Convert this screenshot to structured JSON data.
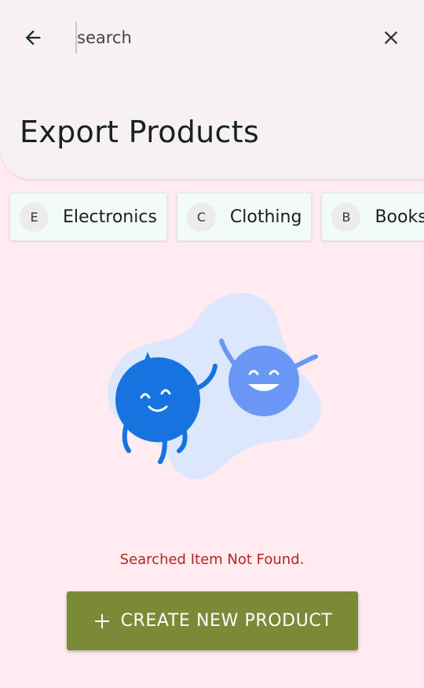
{
  "search": {
    "placeholder": "search",
    "value": ""
  },
  "header": {
    "title": "Export Products"
  },
  "categories": [
    {
      "initial": "E",
      "label": "Electronics"
    },
    {
      "initial": "C",
      "label": "Clothing"
    },
    {
      "initial": "B",
      "label": "Books"
    }
  ],
  "empty_state": {
    "message": "Searched Item Not Found."
  },
  "actions": {
    "create_label": "CREATE NEW PRODUCT"
  },
  "colors": {
    "header_bg": "#F8F1F3",
    "page_bg": "#FFEBF0",
    "chip_bg": "#F2FBF7",
    "error_text": "#B3261E",
    "primary_button": "#7B8A36"
  },
  "icons": {
    "back": "arrow-left-icon",
    "clear": "close-icon",
    "add": "plus-icon"
  }
}
